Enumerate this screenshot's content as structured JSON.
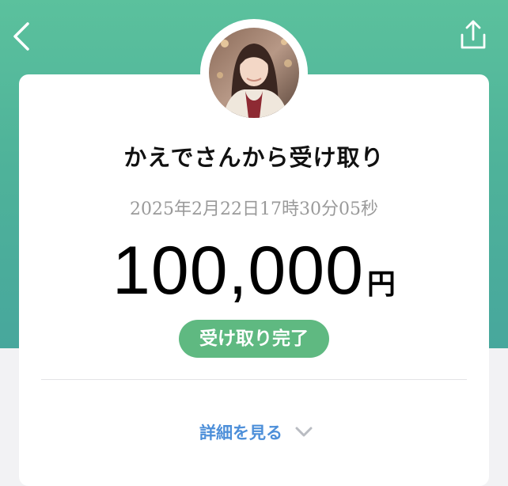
{
  "header": {
    "back_icon": "chevron-left-icon",
    "share_icon": "share-icon",
    "background_color": "#56b99b"
  },
  "card": {
    "title": "かえでさんから受け取り",
    "timestamp": "2025年2月22日17時30分05秒",
    "amount": "100,000",
    "currency": "円",
    "status_label": "受け取り完了",
    "status_color": "#5fb981",
    "details_label": "詳細を見る",
    "details_icon": "chevron-down-icon",
    "link_color": "#4d8fd9"
  }
}
